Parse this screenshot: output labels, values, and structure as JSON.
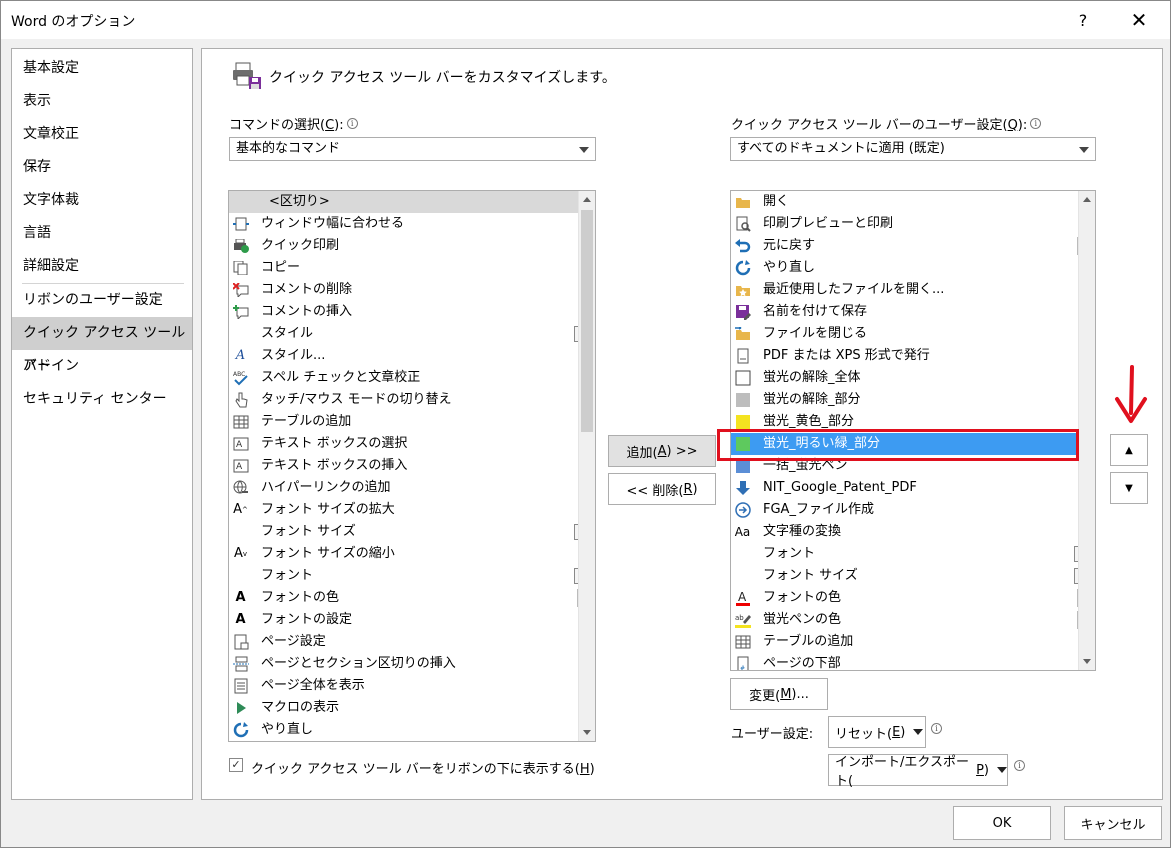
{
  "window": {
    "title": "Word のオプション",
    "help": "?",
    "close": "✕"
  },
  "nav": {
    "items": [
      "基本設定",
      "表示",
      "文章校正",
      "保存",
      "文字体裁",
      "言語",
      "詳細設定",
      "リボンのユーザー設定",
      "クイック アクセス ツール バー",
      "アドイン",
      "セキュリティ センター"
    ]
  },
  "heading": "クイック アクセス ツール バーをカスタマイズします。",
  "commands": {
    "label_pre": "コマンドの選択(",
    "label_key": "C",
    "label_post": "):",
    "selected": "基本的なコマンド",
    "items": [
      "<区切り>",
      "ウィンドウ幅に合わせる",
      "クイック印刷",
      "コピー",
      "コメントの削除",
      "コメントの挿入",
      "スタイル",
      "スタイル...",
      "スペル チェックと文章校正",
      "タッチ/マウス モードの切り替え",
      "テーブルの追加",
      "テキスト ボックスの選択",
      "テキスト ボックスの挿入",
      "ハイパーリンクの追加",
      "フォント サイズの拡大",
      "フォント サイズ",
      "フォント サイズの縮小",
      "フォント",
      "フォントの色",
      "フォントの設定",
      "ページ設定",
      "ページとセクション区切りの挿入",
      "ページ全体を表示",
      "マクロの表示",
      "やり直し"
    ]
  },
  "qat": {
    "label_pre": "クイック アクセス ツール バーのユーザー設定(",
    "label_key": "Q",
    "label_post": "):",
    "selected": "すべてのドキュメントに適用 (既定)",
    "items": [
      "開く",
      "印刷プレビューと印刷",
      "元に戻す",
      "やり直し",
      "最近使用したファイルを開く...",
      "名前を付けて保存",
      "ファイルを閉じる",
      "PDF または XPS 形式で発行",
      "蛍光の解除_全体",
      "蛍光の解除_部分",
      "蛍光_黄色_部分",
      "蛍光_明るい緑_部分",
      "一括_蛍光ペン",
      "NIT_Google_Patent_PDF",
      "FGA_ファイル作成",
      "文字種の変換",
      "フォント",
      "フォント サイズ",
      "フォントの色",
      "蛍光ペンの色",
      "テーブルの追加",
      "ページの下部"
    ]
  },
  "buttons": {
    "add_pre": "追加(",
    "add_key": "A",
    "add_post": ") >>",
    "remove_pre": "<< 削除(",
    "remove_key": "R",
    "remove_post": ")",
    "modify_pre": "変更(",
    "modify_key": "M",
    "modify_post": ")...",
    "up": "▲",
    "down": "▼",
    "ok": "OK",
    "cancel": "キャンセル"
  },
  "user_settings": {
    "label": "ユーザー設定:",
    "reset_pre": "リセット(",
    "reset_key": "E",
    "reset_post": ")",
    "import_export_pre": "インポート/エクスポート(",
    "import_export_key": "P",
    "import_export_post": ")"
  },
  "checkbox": {
    "checked": true,
    "label_pre": "クイック アクセス ツール バーをリボンの下に表示する(",
    "label_key": "H",
    "label_post": ")"
  },
  "colors": {
    "selection": "#3d9bf2",
    "highlight_frame": "#e0101e",
    "arrow": "#e0101e"
  }
}
